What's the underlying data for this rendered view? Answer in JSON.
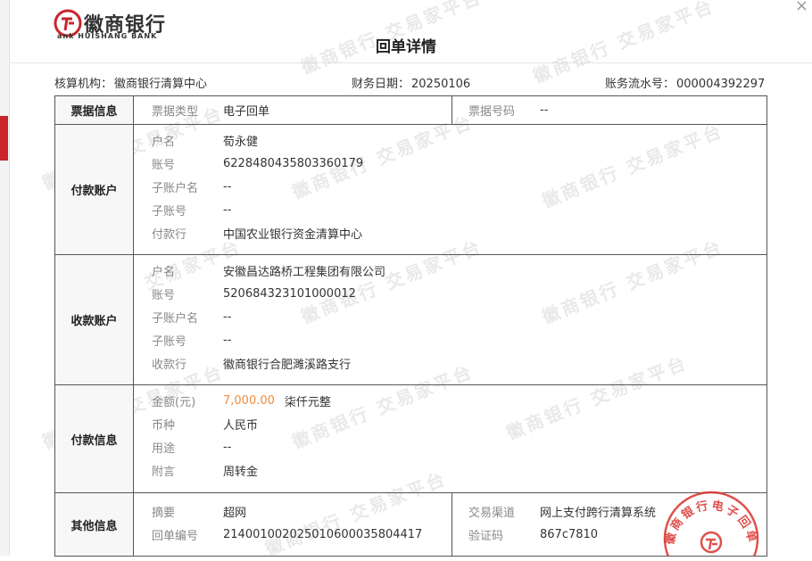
{
  "bank": {
    "name_cn": "徽商银行",
    "name_en_prefix": "ank",
    "name_en_rest": "HUISHANG BANK"
  },
  "page_title": "回单详情",
  "meta": {
    "org_label": "核算机构：",
    "org_value": "徽商银行清算中心",
    "date_label": "财务日期：",
    "date_value": "20250106",
    "serial_label": "账务流水号：",
    "serial_value": "000004392297"
  },
  "ticket": {
    "title": "票据信息",
    "type_label": "票据类型",
    "type_value": "电子回单",
    "number_label": "票据号码",
    "number_value": "--"
  },
  "payer": {
    "title": "付款账户",
    "rows": [
      {
        "label": "户名",
        "value": "荀永健"
      },
      {
        "label": "账号",
        "value": "6228480435803360179"
      },
      {
        "label": "子账户名",
        "value": "--"
      },
      {
        "label": "子账号",
        "value": "--"
      },
      {
        "label": "付款行",
        "value": "中国农业银行资金清算中心"
      }
    ]
  },
  "payee": {
    "title": "收款账户",
    "rows": [
      {
        "label": "户名",
        "value": "安徽昌达路桥工程集团有限公司"
      },
      {
        "label": "账号",
        "value": "520684323101000012"
      },
      {
        "label": "子账户名",
        "value": "--"
      },
      {
        "label": "子账号",
        "value": "--"
      },
      {
        "label": "收款行",
        "value": "徽商银行合肥濉溪路支行"
      }
    ]
  },
  "payment": {
    "title": "付款信息",
    "amount_label": "金额(元)",
    "amount_value": "7,000.00",
    "amount_cn": "柒仟元整",
    "currency_label": "币种",
    "currency_value": "人民币",
    "purpose_label": "用途",
    "purpose_value": "--",
    "note_label": "附言",
    "note_value": "周转金"
  },
  "other": {
    "title": "其他信息",
    "summary_label": "摘要",
    "summary_value": "超网",
    "receipt_no_label": "回单编号",
    "receipt_no_value": "21400100202501060003580441 7",
    "channel_label": "交易渠道",
    "channel_value": "网上支付跨行清算系统",
    "verify_label": "验证码",
    "verify_value": "867c7810"
  },
  "stamp_text": "徽商银行电子回单",
  "watermark_text": "徽商银行 交易家平台",
  "colors": {
    "brand_red": "#c9252b",
    "amount_orange": "#f08c3c",
    "border": "#555555"
  }
}
